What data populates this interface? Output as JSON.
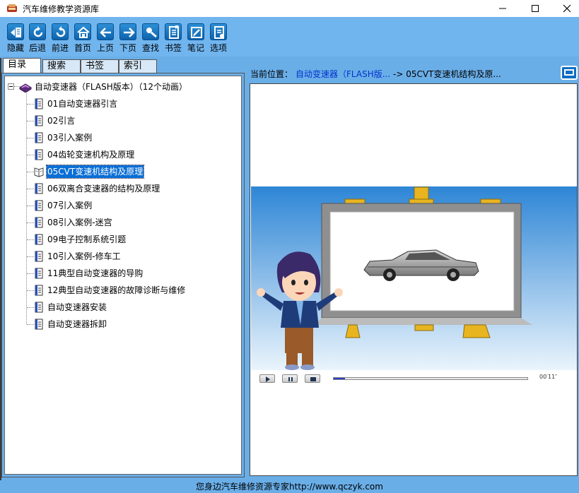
{
  "window": {
    "title": "汽车维修教学资源库",
    "controls": [
      "minimize-icon",
      "maximize-icon",
      "close-icon"
    ]
  },
  "toolbar": {
    "buttons": [
      {
        "label": "隐藏",
        "icon": "hide-panel-icon"
      },
      {
        "label": "后退",
        "icon": "back-refresh-icon"
      },
      {
        "label": "前进",
        "icon": "forward-refresh-icon"
      },
      {
        "label": "首页",
        "icon": "home-icon"
      },
      {
        "label": "上页",
        "icon": "arrow-left-icon"
      },
      {
        "label": "下页",
        "icon": "arrow-right-icon"
      },
      {
        "label": "查找",
        "icon": "search-icon"
      },
      {
        "label": "书签",
        "icon": "bookmark-icon"
      },
      {
        "label": "笔记",
        "icon": "note-icon"
      },
      {
        "label": "选项",
        "icon": "options-icon"
      }
    ]
  },
  "tabs": [
    {
      "label": "目录",
      "active": true
    },
    {
      "label": "搜索",
      "active": false
    },
    {
      "label": "书签",
      "active": false
    },
    {
      "label": "索引",
      "active": false
    }
  ],
  "tree": {
    "root": {
      "label": "自动变速器（FLASH版本）（12个动画）",
      "icon": "book-icon",
      "expanded": true
    },
    "items": [
      {
        "label": "01自动变速器引言",
        "selected": false
      },
      {
        "label": "02引言",
        "selected": false
      },
      {
        "label": "03引入案例",
        "selected": false
      },
      {
        "label": "04齿轮变速机构及原理",
        "selected": false
      },
      {
        "label": "05CVT变速机结构及原理",
        "selected": true
      },
      {
        "label": "06双离合变速器的结构及原理",
        "selected": false
      },
      {
        "label": "07引入案例",
        "selected": false
      },
      {
        "label": "08引入案例-迷宫",
        "selected": false
      },
      {
        "label": "09电子控制系统引题",
        "selected": false
      },
      {
        "label": "10引入案例-修车工",
        "selected": false
      },
      {
        "label": "11典型自动变速器的导购",
        "selected": false
      },
      {
        "label": "12典型自动变速器的故障诊断与维修",
        "selected": false
      },
      {
        "label": "自动变速器安装",
        "selected": false
      },
      {
        "label": "自动变速器拆卸",
        "selected": false
      }
    ]
  },
  "location": {
    "label": "当前位置：",
    "path": "自动变速器（FLASH版...",
    "separator": " -> ",
    "current": "05CVT变速机结构及原..."
  },
  "player": {
    "time": "00′11″",
    "progress": 0.06,
    "buttons": [
      "play-icon",
      "pause-icon",
      "stop-icon"
    ]
  },
  "status": {
    "text": "您身边汽车维修资源专家http://www.qczyk.com"
  },
  "colors": {
    "frame": "#6aaee8",
    "toolbar": "#71b5ef",
    "selection": "#0a6fd6",
    "link": "#0033cc"
  }
}
